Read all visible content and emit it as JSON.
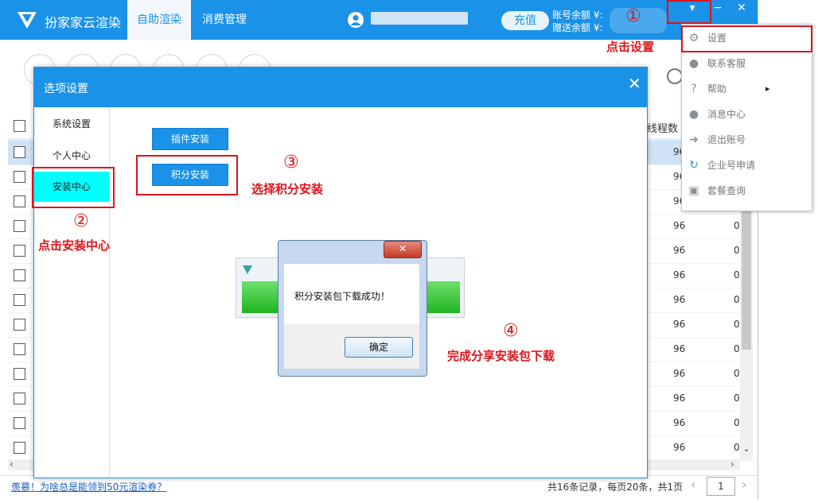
{
  "app": {
    "title": "扮家家云渲染",
    "tabs": [
      "自助渲染",
      "消费管理"
    ],
    "recharge": "充值",
    "balance_label_1": "账号余额 ¥:",
    "balance_label_2": "赠送余额 ¥:",
    "win_dropdown": "▾",
    "win_min": "−",
    "win_close": "✕"
  },
  "table": {
    "header_thread": "线程数",
    "thread_value": "96",
    "trailing_value": "0",
    "records": "共16条记录，每页20条，共1页",
    "page": "1",
    "promo": "羡慕！为啥总是能领到50元渲染券？"
  },
  "dialog": {
    "title": "选项设置",
    "close": "✕",
    "sidebar": [
      "系统设置",
      "个人中心",
      "安装中心"
    ],
    "plugin_install": "插件安装",
    "points_install": "积分安装"
  },
  "message_box": {
    "close": "✕",
    "text": "积分安装包下载成功！",
    "ok": "确定"
  },
  "menu": {
    "items": [
      {
        "label": "设置",
        "icon": "gear-icon"
      },
      {
        "label": "联系客服",
        "icon": "bell-icon"
      },
      {
        "label": "帮助",
        "icon": "question-icon"
      },
      {
        "label": "消息中心",
        "icon": "bell-icon"
      },
      {
        "label": "退出账号",
        "icon": "logout-icon"
      },
      {
        "label": "企业号申请",
        "icon": "refresh-icon"
      },
      {
        "label": "套餐查询",
        "icon": "box-icon"
      }
    ],
    "submenu_arrow": "▸"
  },
  "annotations": {
    "n1": "①",
    "t1": "点击设置",
    "n2": "②",
    "t2": "点击安装中心",
    "n3": "③",
    "t3": "选择积分安装",
    "n4": "④",
    "t4": "完成分享安装包下载"
  },
  "colors": {
    "accent": "#1a92e8",
    "annotation": "#e0141b",
    "active_side": "#00ffff"
  }
}
